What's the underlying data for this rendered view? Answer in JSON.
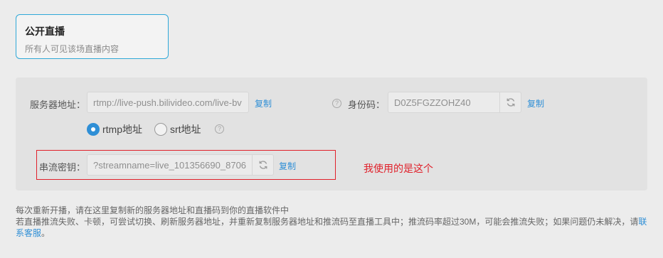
{
  "mode_card": {
    "title": "公开直播",
    "description": "所有人可见该场直播内容"
  },
  "server": {
    "label": "服务器地址：",
    "value": "rtmp://live-push.bilivideo.com/live-bv",
    "copy_label": "复制"
  },
  "identity": {
    "label": "身份码：",
    "value": "D0Z5FGZZOHZ40",
    "copy_label": "复制"
  },
  "protocol": {
    "options": [
      {
        "label": "rtmp地址",
        "selected": true
      },
      {
        "label": "srt地址",
        "selected": false
      }
    ]
  },
  "stream_key": {
    "label": "串流密钥：",
    "value": "?streamname=live_101356690_8706",
    "copy_label": "复制"
  },
  "annotation": "我使用的是这个",
  "notes": {
    "line1": "每次重新开播，请在这里复制新的服务器地址和直播码到你的直播软件中",
    "line2_prefix": "若直播推流失败、卡顿，可尝试切换、刷新服务器地址，并重新复制服务器地址和推流码至直播工具中；推流码率超过30M，可能会推流失败；如果问题仍未解决，请",
    "link": "联系客服",
    "line2_suffix": "。"
  },
  "icons": {
    "help": "question-circle-icon",
    "refresh": "refresh-icon"
  },
  "colors": {
    "accent": "#2f8fd6",
    "annotation_red": "#e0202a",
    "card_border": "#2fa8d8"
  }
}
